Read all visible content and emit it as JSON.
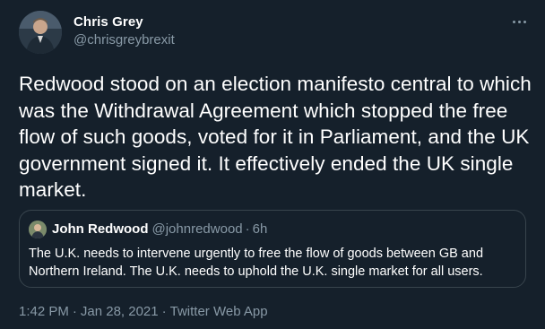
{
  "tweet": {
    "author_name": "Chris Grey",
    "author_handle": "@chrisgreybrexit",
    "text": "Redwood stood on an election manifesto central to which was the Withdrawal Agreement which stopped the free flow of such goods, voted for it in Parliament, and the UK government signed it. It effectively ended the UK single market.",
    "time": "1:42 PM",
    "date": "Jan 28, 2021",
    "separator": "·",
    "source_app": "Twitter Web App",
    "more_icon": "more-horizontal-icon"
  },
  "quoted_tweet": {
    "author_name": "John Redwood",
    "author_handle": "@johnredwood",
    "separator": "·",
    "relative_time": "6h",
    "text": "The U.K. needs to intervene urgently to free the flow of goods between GB and Northern Ireland. The U.K. needs to uphold the U.K. single market for all users."
  },
  "colors": {
    "background": "#15202b",
    "primary_text": "#ffffff",
    "secondary_text": "#8899a6",
    "border": "#38444d"
  }
}
